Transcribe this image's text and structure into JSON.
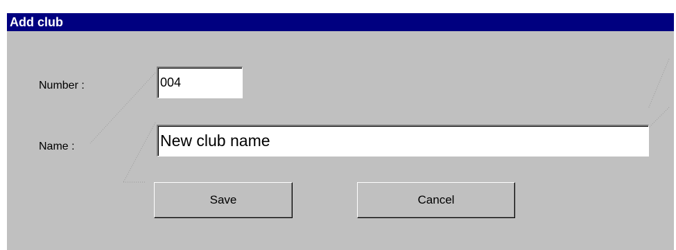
{
  "window": {
    "title": "Add club"
  },
  "form": {
    "number_label": "Number :",
    "number_value": "004",
    "name_label": "Name :",
    "name_value": "New club name"
  },
  "buttons": {
    "save_label": "Save",
    "cancel_label": "Cancel"
  },
  "colors": {
    "titlebar": "#000080",
    "dialog_face": "#c0c0c0"
  }
}
